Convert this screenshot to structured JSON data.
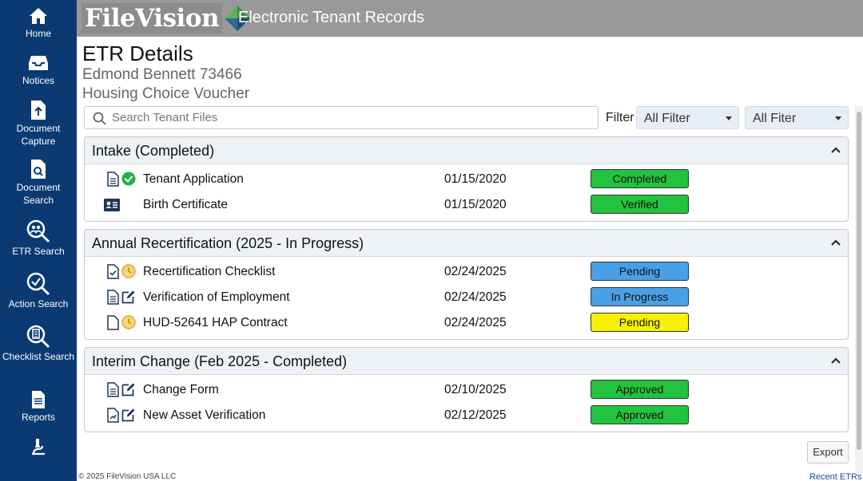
{
  "sidebar": {
    "items": [
      {
        "label": "Home",
        "icon": "home-icon"
      },
      {
        "label": "Notices",
        "icon": "inbox-icon"
      },
      {
        "label": "Document Capture",
        "icon": "file-upload-icon"
      },
      {
        "label": "Document Search",
        "icon": "file-search-icon"
      },
      {
        "label": "ETR Search",
        "icon": "people-search-icon"
      },
      {
        "label": "Action Search",
        "icon": "check-search-icon"
      },
      {
        "label": "Checklist Search",
        "icon": "checklist-search-icon"
      },
      {
        "label": "Reports",
        "icon": "report-icon"
      },
      {
        "label": "",
        "icon": "microscope-icon"
      }
    ]
  },
  "header": {
    "logo": "FileVision",
    "title": "Electronic Tenant Records"
  },
  "page": {
    "title": "ETR Details",
    "tenant": "Edmond Bennett 73466",
    "program": "Housing Choice Voucher"
  },
  "search": {
    "placeholder": "Search Tenant Files"
  },
  "filter": {
    "label": "Filter",
    "select1": "All Filter",
    "select2": "All Fiter"
  },
  "sections": [
    {
      "title": "Intake (Completed)",
      "rows": [
        {
          "name": "Tenant Application",
          "date": "01/15/2020",
          "status": "Completed",
          "status_color": "#22c33e",
          "icons": [
            "document-icon",
            "check-circle-icon"
          ]
        },
        {
          "name": "Birth Certificate",
          "date": "01/15/2020",
          "status": "Verified",
          "status_color": "#22c33e",
          "icons": [
            "id-card-icon"
          ]
        }
      ]
    },
    {
      "title": "Annual Recertification (2025 - In Progress)",
      "rows": [
        {
          "name": "Recertification Checklist",
          "date": "02/24/2025",
          "status": "Pending",
          "status_color": "#4aa0e6",
          "icons": [
            "checklist-document-icon",
            "pending-coin-icon"
          ]
        },
        {
          "name": "Verification of Employment",
          "date": "02/24/2025",
          "status": "In Progress",
          "status_color": "#4aa0e6",
          "icons": [
            "document-icon",
            "edit-icon"
          ]
        },
        {
          "name": "HUD-52641 HAP Contract",
          "date": "02/24/2025",
          "status": "Pending",
          "status_color": "#f7f200",
          "icons": [
            "blank-document-icon",
            "pending-coin-icon"
          ]
        }
      ]
    },
    {
      "title": "Interim Change (Feb 2025 - Completed)",
      "rows": [
        {
          "name": "Change Form",
          "date": "02/10/2025",
          "status": "Approved",
          "status_color": "#22c33e",
          "icons": [
            "document-icon",
            "edit-icon"
          ]
        },
        {
          "name": "New Asset Verification",
          "date": "02/12/2025",
          "status": "Approved",
          "status_color": "#22c33e",
          "icons": [
            "asset-document-icon",
            "edit-icon"
          ]
        }
      ]
    }
  ],
  "footer": {
    "export": "Export",
    "copyright": "© 2025 FileVision USA LLC",
    "recent": "Recent ETRs"
  }
}
